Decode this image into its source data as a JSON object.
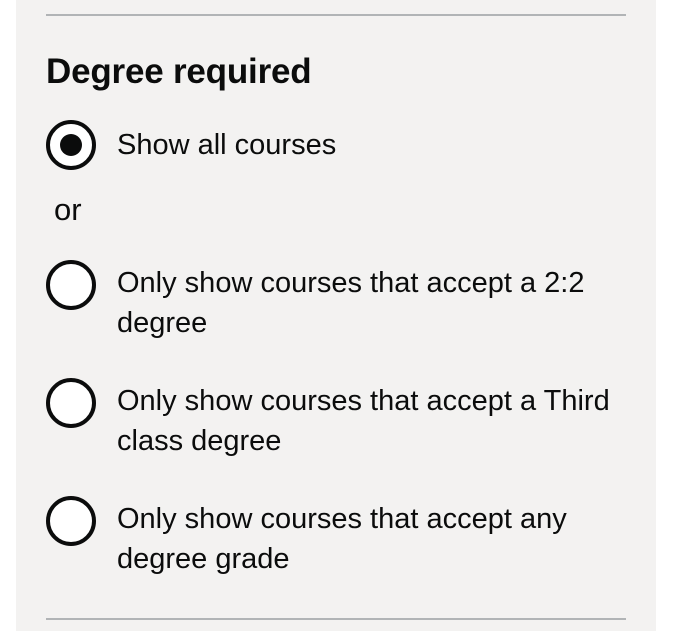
{
  "filter": {
    "legend": "Degree required",
    "or_divider": "or",
    "options": [
      {
        "label": "Show all courses",
        "checked": true
      },
      {
        "label": "Only show courses that accept a 2:2 degree",
        "checked": false
      },
      {
        "label": "Only show courses that accept a Third class degree",
        "checked": false
      },
      {
        "label": "Only show courses that accept any degree grade",
        "checked": false
      }
    ]
  }
}
